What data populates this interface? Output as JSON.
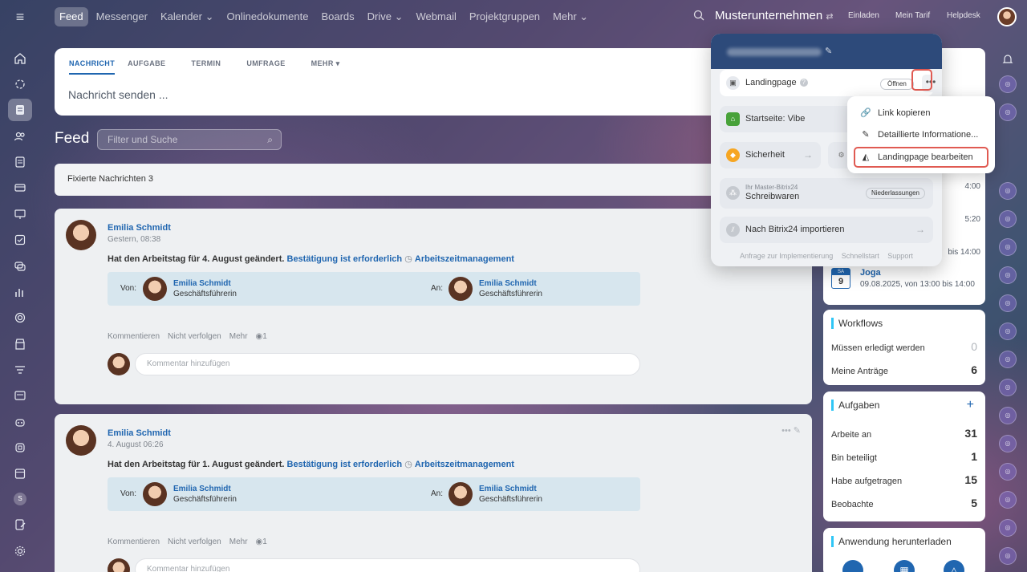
{
  "topbar": {
    "nav": [
      "Feed",
      "Messenger",
      "Kalender",
      "Onlinedokumente",
      "Boards",
      "Drive",
      "Webmail",
      "Projektgruppen",
      "Mehr"
    ],
    "company": "Musterunternehmen",
    "invite": "Einladen",
    "tariff": "Mein Tarif",
    "helpdesk": "Helpdesk"
  },
  "composer": {
    "tabs": [
      "NACHRICHT",
      "AUFGABE",
      "TERMIN",
      "UMFRAGE",
      "MEHR"
    ],
    "placeholder": "Nachricht senden ..."
  },
  "feed": {
    "title": "Feed",
    "filter_placeholder": "Filter und Suche",
    "pinned": "Fixierte Nachrichten 3"
  },
  "posts": [
    {
      "author": "Emilia Schmidt",
      "time": "Gestern, 08:38",
      "text": "Hat den Arbeitstag für 4. August geändert.",
      "confirm": "Bestätigung ist erforderlich",
      "tag": "Arbeitszeitmanagement",
      "from_label": "Von:",
      "from_name": "Emilia Schmidt",
      "from_role": "Geschäftsführerin",
      "to_label": "An:",
      "to_name": "Emilia Schmidt",
      "to_role": "Geschäftsführerin",
      "actions": [
        "Kommentieren",
        "Nicht verfolgen",
        "Mehr",
        "1"
      ],
      "comment_placeholder": "Kommentar hinzufügen"
    },
    {
      "author": "Emilia Schmidt",
      "time": "4. August 06:26",
      "text": "Hat den Arbeitstag für 1. August geändert.",
      "confirm": "Bestätigung ist erforderlich",
      "tag": "Arbeitszeitmanagement",
      "from_label": "Von:",
      "from_name": "Emilia Schmidt",
      "from_role": "Geschäftsführerin",
      "to_label": "An:",
      "to_name": "Emilia Schmidt",
      "to_role": "Geschäftsführerin",
      "actions": [
        "Kommentieren",
        "Nicht verfolgen",
        "Mehr",
        "1"
      ],
      "comment_placeholder": "Kommentar hinzufügen"
    }
  ],
  "calendar": {
    "times": [
      "4:00",
      "5:20",
      "bis 14:00"
    ],
    "event_weekday": "SA",
    "event_day": "9",
    "event_title": "Joga",
    "event_sub": "09.08.2025, von 13:00 bis 14:00"
  },
  "workflows": {
    "title": "Workflows",
    "rows": [
      {
        "label": "Müssen erledigt werden",
        "value": "0"
      },
      {
        "label": "Meine Anträge",
        "value": "6"
      }
    ]
  },
  "tasks": {
    "title": "Aufgaben",
    "rows": [
      {
        "label": "Arbeite an",
        "value": "31"
      },
      {
        "label": "Bin beteiligt",
        "value": "1"
      },
      {
        "label": "Habe aufgetragen",
        "value": "15"
      },
      {
        "label": "Beobachte",
        "value": "5"
      }
    ]
  },
  "download": {
    "title": "Anwendung herunterladen"
  },
  "popup": {
    "landing_label": "Landingpage",
    "open_label": "Öffnen",
    "start_label": "Startseite: Vibe",
    "security_label": "Sicherheit",
    "master_small": "Ihr Master-Bitrix24",
    "master_name": "Schreibwaren",
    "branches": "Niederlassungen",
    "import_label": "Nach Bitrix24 importieren",
    "footer": [
      "Anfrage zur Implementierung",
      "Schnellstart",
      "Support"
    ]
  },
  "submenu": {
    "items": [
      "Link kopieren",
      "Detaillierte Informatione...",
      "Landingpage bearbeiten"
    ]
  },
  "leftbar": {
    "user_initial": "S"
  },
  "colors": {
    "accent": "#2066b0",
    "highlight": "#e05a52"
  }
}
